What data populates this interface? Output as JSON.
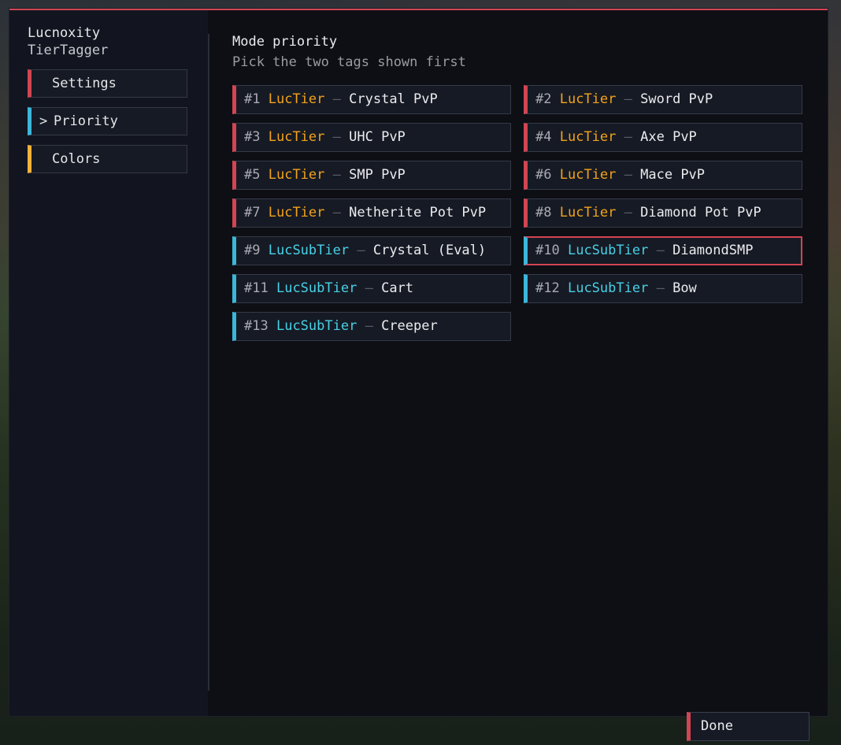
{
  "sidebar": {
    "brand_title": "Lucnoxity",
    "brand_subtitle": "TierTagger",
    "items": [
      {
        "label": "Settings",
        "accent": "#d24552"
      },
      {
        "label": "Priority",
        "accent": "#3cb6d9",
        "active": true,
        "chevron": ">"
      },
      {
        "label": "Colors",
        "accent": "#f2b33b"
      }
    ]
  },
  "main": {
    "title": "Mode priority",
    "subtitle": "Pick the two tags shown first",
    "tags": [
      {
        "rank": "#1",
        "tier": "LucTier",
        "mode": "Crystal PvP"
      },
      {
        "rank": "#2",
        "tier": "LucTier",
        "mode": "Sword PvP"
      },
      {
        "rank": "#3",
        "tier": "LucTier",
        "mode": "UHC PvP"
      },
      {
        "rank": "#4",
        "tier": "LucTier",
        "mode": "Axe PvP"
      },
      {
        "rank": "#5",
        "tier": "LucTier",
        "mode": "SMP PvP"
      },
      {
        "rank": "#6",
        "tier": "LucTier",
        "mode": "Mace PvP"
      },
      {
        "rank": "#7",
        "tier": "LucTier",
        "mode": "Netherite Pot PvP"
      },
      {
        "rank": "#8",
        "tier": "LucTier",
        "mode": "Diamond Pot PvP"
      },
      {
        "rank": "#9",
        "tier": "LucSubTier",
        "mode": "Crystal (Eval)"
      },
      {
        "rank": "#10",
        "tier": "LucSubTier",
        "mode": "DiamondSMP",
        "selected": true
      },
      {
        "rank": "#11",
        "tier": "LucSubTier",
        "mode": "Cart"
      },
      {
        "rank": "#12",
        "tier": "LucSubTier",
        "mode": "Bow"
      },
      {
        "rank": "#13",
        "tier": "LucSubTier",
        "mode": "Creeper"
      }
    ],
    "separator": "–"
  },
  "footer": {
    "done_label": "Done"
  },
  "colors": {
    "accent_red": "#d24552",
    "accent_blue": "#3cb6d9",
    "accent_yellow": "#f2b33b",
    "tier_main": "#f2a31c",
    "tier_sub": "#47d1e6"
  }
}
